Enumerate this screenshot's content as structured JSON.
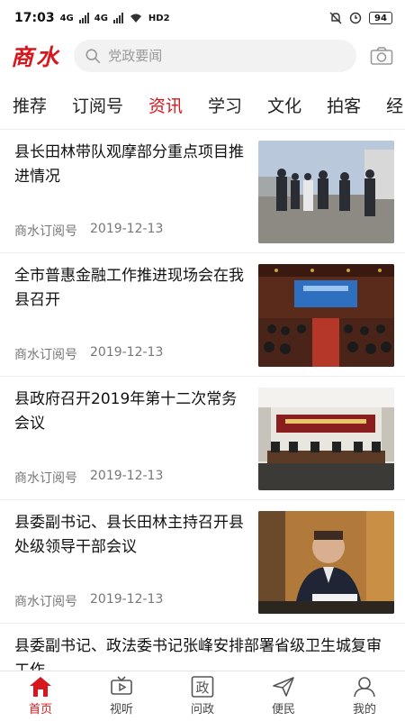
{
  "status_bar": {
    "time": "17:03",
    "network_1": "4G",
    "network_2": "4G",
    "hd_label": "HD2",
    "battery": "94"
  },
  "header": {
    "brand": "商水",
    "search_placeholder": "党政要闻"
  },
  "tabs": [
    {
      "label": "推荐",
      "active": false
    },
    {
      "label": "订阅号",
      "active": false
    },
    {
      "label": "资讯",
      "active": true
    },
    {
      "label": "学习",
      "active": false
    },
    {
      "label": "文化",
      "active": false
    },
    {
      "label": "拍客",
      "active": false
    },
    {
      "label": "经",
      "active": false
    }
  ],
  "articles": [
    {
      "title": "县长田林带队观摩部分重点项目推进情况",
      "source": "商水订阅号",
      "date": "2019-12-13"
    },
    {
      "title": "全市普惠金融工作推进现场会在我县召开",
      "source": "商水订阅号",
      "date": "2019-12-13"
    },
    {
      "title": "县政府召开2019年第十二次常务会议",
      "source": "商水订阅号",
      "date": "2019-12-13"
    },
    {
      "title": "县委副书记、县长田林主持召开县处级领导干部会议",
      "source": "商水订阅号",
      "date": "2019-12-13"
    },
    {
      "title": "县委副书记、政法委书记张峰安排部署省级卫生城复审工作"
    }
  ],
  "bottom_nav": [
    {
      "label": "首页",
      "icon": "home-icon",
      "active": true
    },
    {
      "label": "视听",
      "icon": "tv-icon",
      "active": false
    },
    {
      "label": "问政",
      "icon": "zheng-icon",
      "active": false,
      "glyph": "政"
    },
    {
      "label": "便民",
      "icon": "send-icon",
      "active": false
    },
    {
      "label": "我的",
      "icon": "user-icon",
      "active": false
    }
  ],
  "colors": {
    "accent": "#d7171d",
    "text": "#111111",
    "meta": "#777777"
  }
}
